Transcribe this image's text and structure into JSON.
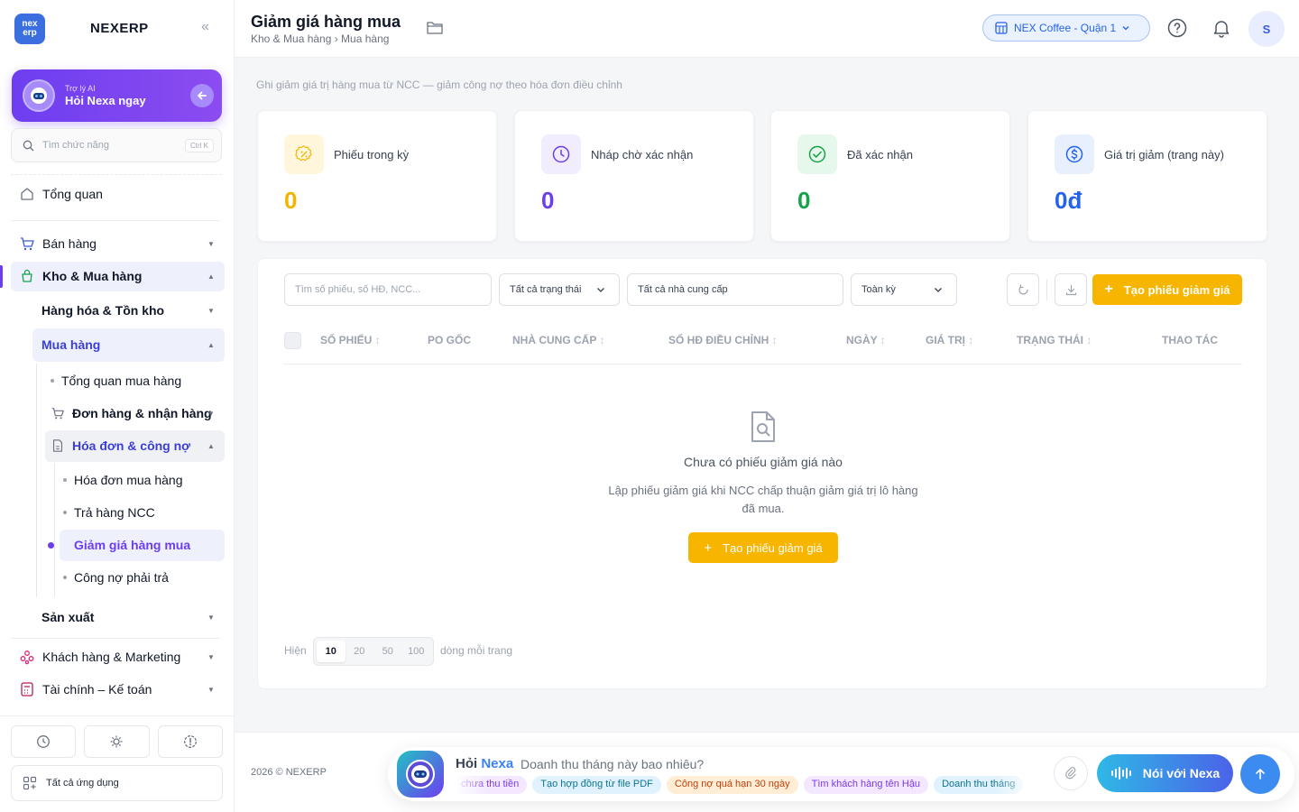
{
  "brand": {
    "logo_text": "nex erp",
    "name": "NEXERP",
    "collapse_glyph": "«"
  },
  "ai_card": {
    "subtitle": "Trợ lý AI",
    "title": "Hỏi Nexa ngay"
  },
  "search": {
    "placeholder": "Tìm chức năng",
    "shortcut": "Ctrl K"
  },
  "sidebar": {
    "overview": "Tổng quan",
    "sales": "Bán hàng",
    "warehouse": "Kho & Mua hàng",
    "goods": "Hàng hóa & Tồn kho",
    "purchasing": "Mua hàng",
    "purchase_overview": "Tổng quan mua hàng",
    "orders": "Đơn hàng & nhận hàng",
    "invoices": "Hóa đơn & công nợ",
    "purchase_invoices": "Hóa đơn mua hàng",
    "returns": "Trả hàng NCC",
    "discounts": "Giảm giá hàng mua",
    "payables": "Công nợ phải trả",
    "production": "Sản xuất",
    "crm": "Khách hàng & Marketing",
    "finance": "Tài chính – Kế toán",
    "all_apps": "Tất cả ứng dụng"
  },
  "header": {
    "title": "Giảm giá hàng mua",
    "breadcrumb": "Kho & Mua hàng › Mua hàng",
    "store": "NEX Coffee - Quận 1",
    "user_initial": "S"
  },
  "page": {
    "description": "Ghi giảm giá trị hàng mua từ NCC — giảm công nợ theo hóa đơn điều chỉnh"
  },
  "stats": [
    {
      "label": "Phiếu trong kỳ",
      "value": "0",
      "color": "#f5b400"
    },
    {
      "label": "Nháp chờ xác nhận",
      "value": "0",
      "color": "#6d3ef0"
    },
    {
      "label": "Đã xác nhận",
      "value": "0",
      "color": "#16a34a"
    },
    {
      "label": "Giá trị giảm (trang này)",
      "value": "0đ",
      "color": "#2563eb"
    }
  ],
  "filters": {
    "search_placeholder": "Tìm số phiếu, số HĐ, NCC...",
    "status": "Tất cả trạng thái",
    "supplier": "Tất cả nhà cung cấp",
    "period": "Toàn kỳ",
    "create_label": "Tạo phiếu giảm giá"
  },
  "table": {
    "columns": [
      "SỐ PHIẾU",
      "PO GỐC",
      "NHÀ CUNG CẤP",
      "SỐ HĐ ĐIỀU CHỈNH",
      "NGÀY",
      "GIÁ TRỊ",
      "TRẠNG THÁI",
      "THAO TÁC"
    ],
    "empty_title": "Chưa có phiếu giảm giá nào",
    "empty_desc": "Lập phiếu giảm giá khi NCC chấp thuận giảm giá trị lô hàng đã mua.",
    "empty_button": "Tạo phiếu giảm giá"
  },
  "pagination": {
    "label_before": "Hiện",
    "options": [
      "10",
      "20",
      "50",
      "100"
    ],
    "selected": "10",
    "label_after": "dòng mỗi trang"
  },
  "footer": {
    "copyright": "2026 © NEXERP",
    "ask_prefix": "Hỏi",
    "ask_name": "Nexa",
    "prompt_placeholder": "Doanh thu tháng này bao nhiêu?",
    "chips": [
      "chưa thu tiền",
      "Tạo hợp đồng từ file PDF",
      "Công nợ quá hạn 30 ngày",
      "Tìm khách hàng tên Hậu",
      "Doanh thu tháng"
    ],
    "talk_label": "Nói với Nexa"
  },
  "colors": {
    "accent": "#6d3ef0",
    "primary_button": "#f7b500",
    "link": "#2563eb"
  }
}
